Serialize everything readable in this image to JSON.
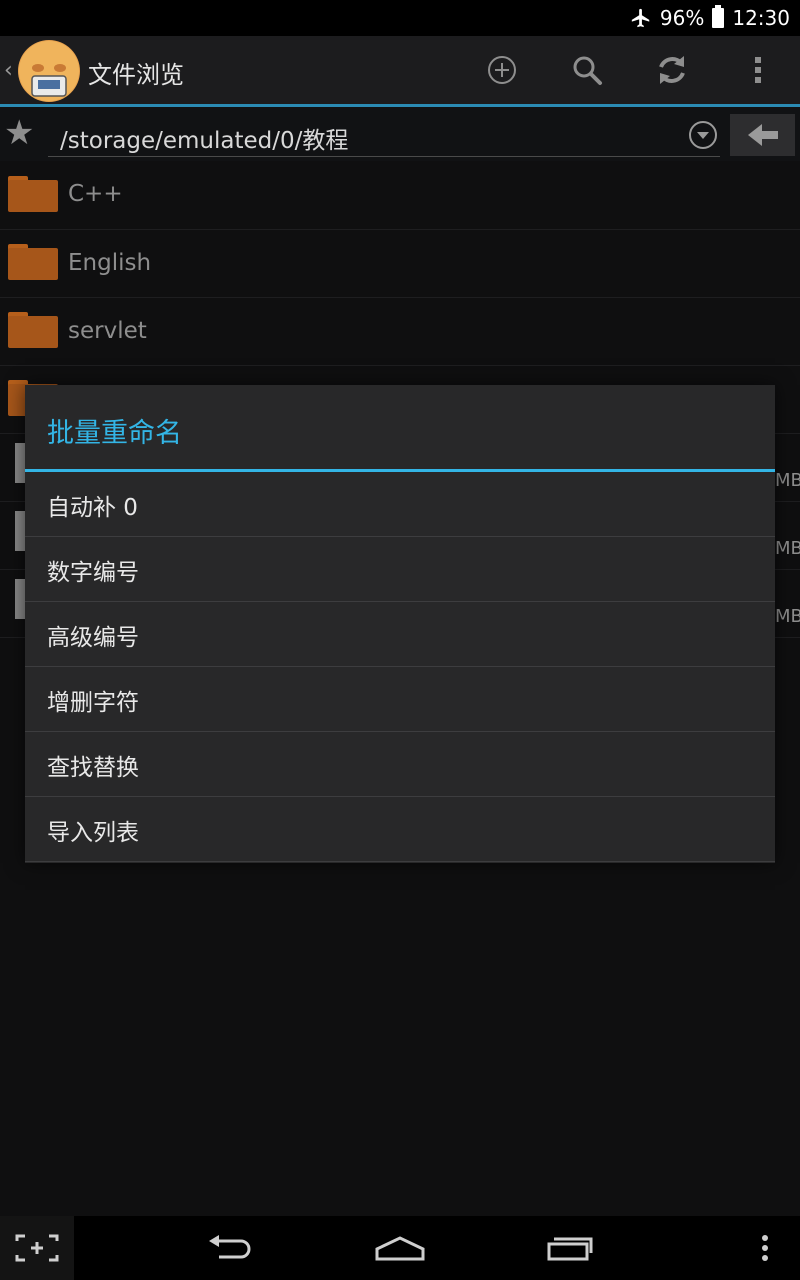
{
  "status": {
    "battery": "96%",
    "time": "12:30",
    "icons": [
      "airplane-icon",
      "battery-icon"
    ]
  },
  "actionbar": {
    "title": "文件浏览",
    "icons": [
      "add-circle-icon",
      "search-icon",
      "refresh-icon",
      "overflow-menu-icon"
    ]
  },
  "path": {
    "value": "/storage/emulated/0/教程"
  },
  "files": [
    {
      "name": "C++"
    },
    {
      "name": "English"
    },
    {
      "name": "servlet"
    }
  ],
  "file_sizes": [
    "MB",
    "MB",
    "MB"
  ],
  "dialog": {
    "title": "批量重命名",
    "items": [
      {
        "label": "自动补 0"
      },
      {
        "label": "数字编号"
      },
      {
        "label": "高级编号"
      },
      {
        "label": "增删字符"
      },
      {
        "label": "查找替换"
      },
      {
        "label": "导入列表"
      }
    ]
  },
  "navbar": {
    "icons": [
      "screenshot-icon",
      "back-icon",
      "home-icon",
      "recents-icon",
      "menu-icon"
    ]
  },
  "colors": {
    "accent": "#33b5e5",
    "folder": "#a6561a",
    "background": "#0f0f10"
  }
}
